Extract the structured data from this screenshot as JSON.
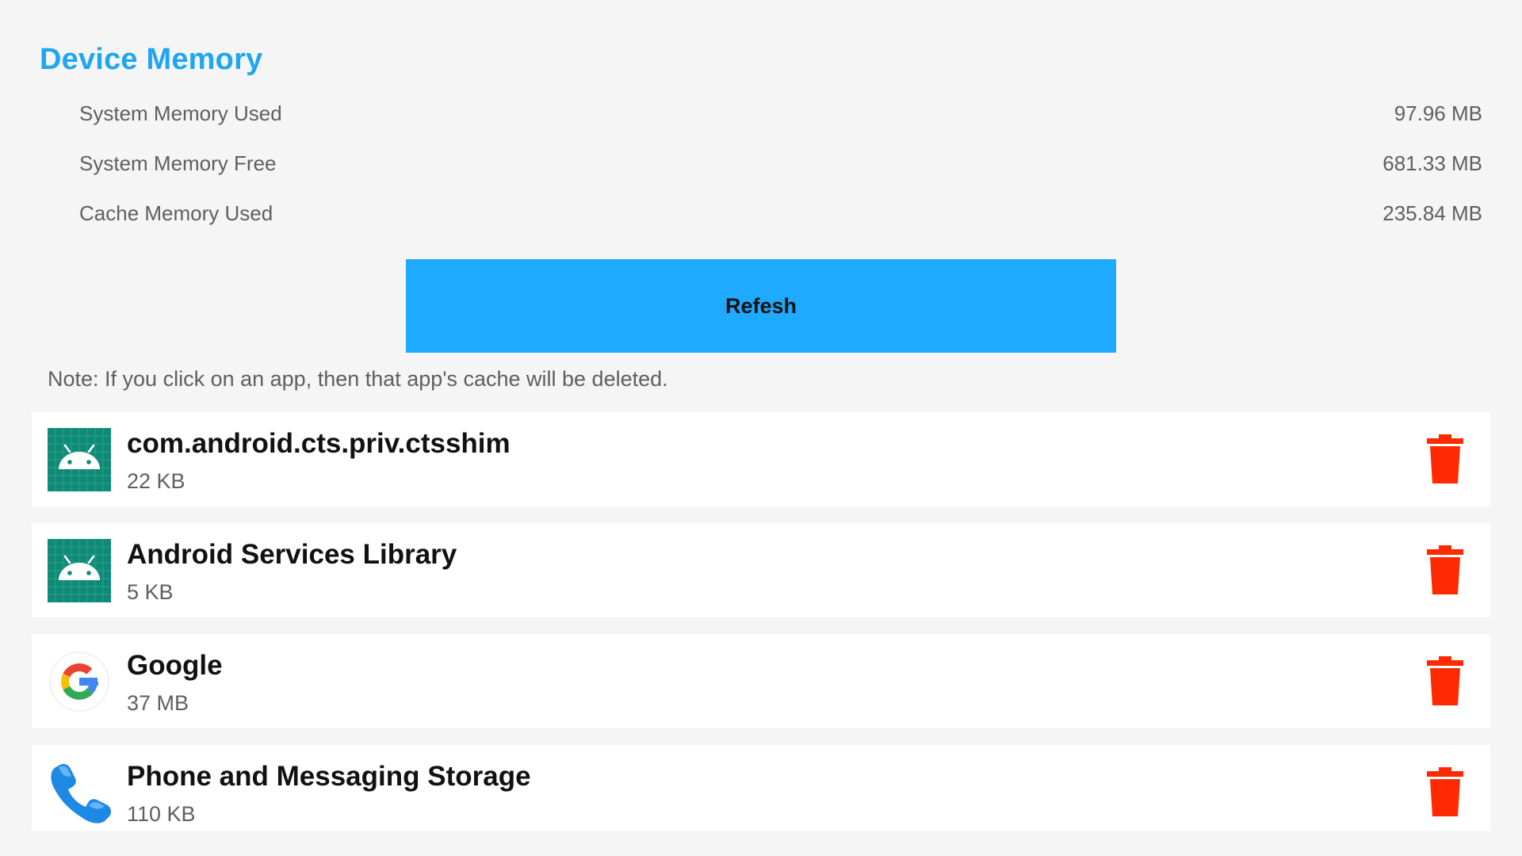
{
  "header": {
    "title": "Device Memory"
  },
  "memory": {
    "rows": [
      {
        "label": "System Memory Used",
        "value": "97.96 MB"
      },
      {
        "label": "System Memory Free",
        "value": "681.33 MB"
      },
      {
        "label": "Cache Memory Used",
        "value": "235.84 MB"
      }
    ]
  },
  "refresh": {
    "label": "Refesh"
  },
  "note": {
    "text": "Note: If you click on an app, then that app's cache will be deleted."
  },
  "apps": [
    {
      "name": "com.android.cts.priv.ctsshim",
      "size": "22 KB",
      "icon": "android-icon"
    },
    {
      "name": "Android Services Library",
      "size": "5 KB",
      "icon": "android-icon"
    },
    {
      "name": "Google",
      "size": "37 MB",
      "icon": "google-icon"
    },
    {
      "name": "Phone and Messaging Storage",
      "size": "110 KB",
      "icon": "phone-icon"
    }
  ],
  "colors": {
    "accent": "#1da6f2",
    "button": "#1eaaff",
    "delete": "#ff2a00",
    "android_tile": "#0f8a76",
    "background": "#f5f5f5"
  }
}
